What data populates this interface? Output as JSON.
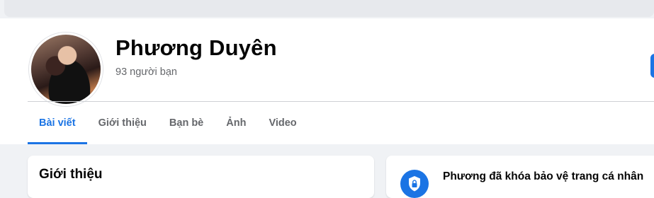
{
  "profile": {
    "name": "Phương Duyên",
    "friends_count": "93 người bạn"
  },
  "tabs": [
    {
      "label": "Bài viết",
      "active": true
    },
    {
      "label": "Giới thiệu",
      "active": false
    },
    {
      "label": "Bạn bè",
      "active": false
    },
    {
      "label": "Ảnh",
      "active": false
    },
    {
      "label": "Video",
      "active": false
    }
  ],
  "intro": {
    "title": "Giới thiệu"
  },
  "lock_notice": {
    "text": "Phương đã khóa bảo vệ trang cá nhân"
  },
  "icons": {
    "avatar": "profile-photo",
    "lock": "shield-lock-icon"
  },
  "colors": {
    "accent": "#1b74e4",
    "background": "#f0f2f5",
    "secondary_text": "#65676b"
  }
}
